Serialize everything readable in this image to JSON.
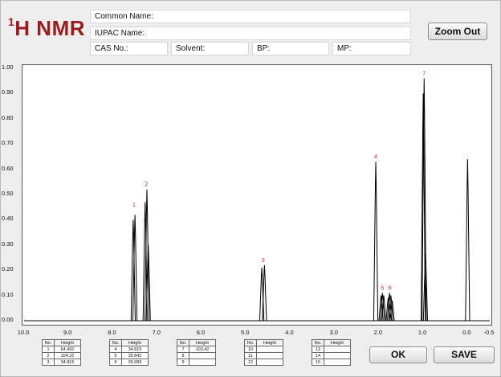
{
  "app": {
    "title_prefix": "1",
    "title_main": "H NMR"
  },
  "fields": {
    "common_name": "Common Name:",
    "iupac_name": "IUPAC Name:",
    "cas_no": "CAS No.:",
    "solvent": "Solvent:",
    "bp": "BP:",
    "mp": "MP:"
  },
  "buttons": {
    "zoom_out": "Zoom Out",
    "ok": "OK",
    "save": "SAVE"
  },
  "colors": {
    "title": "#9b1c1c",
    "peak_label": "#e02020",
    "spectrum": "#000000"
  },
  "tables": {
    "header_no": "No.",
    "header_height": "Height",
    "groups": [
      [
        {
          "no": "1",
          "height": "64.492"
        },
        {
          "no": "2",
          "height": "104.32"
        },
        {
          "no": "3",
          "height": "34.815"
        }
      ],
      [
        {
          "no": "4",
          "height": "34.815"
        },
        {
          "no": "5",
          "height": "35.842"
        },
        {
          "no": "6",
          "height": "35.099"
        }
      ],
      [
        {
          "no": "7",
          "height": "103.42"
        },
        {
          "no": "8",
          "height": ""
        },
        {
          "no": "9",
          "height": ""
        }
      ],
      [
        {
          "no": "10",
          "height": ""
        },
        {
          "no": "11",
          "height": ""
        },
        {
          "no": "12",
          "height": ""
        }
      ],
      [
        {
          "no": "13",
          "height": ""
        },
        {
          "no": "14",
          "height": ""
        },
        {
          "no": "15",
          "height": ""
        }
      ]
    ]
  },
  "chart_data": {
    "type": "line",
    "xlim": [
      10.0,
      -0.5
    ],
    "ylim": [
      0,
      1.0
    ],
    "x_ticks": [
      "10.0",
      "9.0",
      "8.0",
      "7.0",
      "6.0",
      "5.0",
      "4.0",
      "3.0",
      "2.0",
      "1.0",
      "0.0",
      "-0.5"
    ],
    "x_tick_values": [
      10,
      9,
      8,
      7,
      6,
      5,
      4,
      3,
      2,
      1,
      0,
      -0.5
    ],
    "y_ticks": [
      "0.00",
      "0.10",
      "0.20",
      "0.30",
      "0.40",
      "0.50",
      "0.60",
      "0.70",
      "0.80",
      "0.90",
      "1.00"
    ],
    "y_tick_values": [
      0,
      0.1,
      0.2,
      0.3,
      0.4,
      0.5,
      0.6,
      0.7,
      0.8,
      0.9,
      1.0
    ],
    "peaks": [
      {
        "label": "1",
        "x": 7.52,
        "y": 0.44,
        "multiplet": [
          [
            7.54,
            0.4
          ],
          [
            7.5,
            0.42
          ]
        ]
      },
      {
        "label": "2",
        "x": 7.24,
        "y": 0.52,
        "multiplet": [
          [
            7.27,
            0.47
          ],
          [
            7.23,
            0.52
          ],
          [
            7.2,
            0.3
          ]
        ]
      },
      {
        "label": "3",
        "x": 4.61,
        "y": 0.22,
        "multiplet": [
          [
            4.64,
            0.21
          ],
          [
            4.58,
            0.22
          ]
        ]
      },
      {
        "label": "4",
        "x": 2.07,
        "y": 0.63,
        "multiplet": [
          [
            2.07,
            0.63
          ]
        ]
      },
      {
        "label": "5",
        "x": 1.92,
        "y": 0.11,
        "multiplet": [
          [
            1.95,
            0.1
          ],
          [
            1.92,
            0.11
          ],
          [
            1.89,
            0.1
          ]
        ]
      },
      {
        "label": "6",
        "x": 1.75,
        "y": 0.11,
        "multiplet": [
          [
            1.79,
            0.09
          ],
          [
            1.76,
            0.11
          ],
          [
            1.73,
            0.1
          ],
          [
            1.7,
            0.08
          ]
        ]
      },
      {
        "label": "7",
        "x": 0.98,
        "y": 0.96,
        "multiplet": [
          [
            1.0,
            0.9
          ],
          [
            0.98,
            0.96
          ],
          [
            0.95,
            0.27
          ]
        ]
      },
      {
        "label": "",
        "x": 0.0,
        "y": 0.64,
        "multiplet": [
          [
            0.0,
            0.64
          ]
        ]
      }
    ]
  }
}
